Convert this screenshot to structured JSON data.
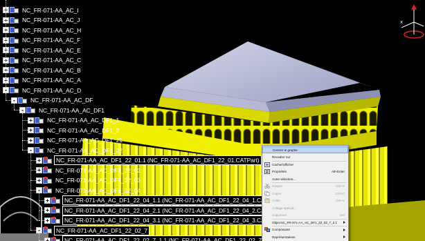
{
  "spec_tree": {
    "nodes": [
      {
        "label": "NC_FR-071-AA_AC_I",
        "level": 0,
        "expander": "+",
        "highlighted": false
      },
      {
        "label": "NC_FR-071-AA_AC_J",
        "level": 0,
        "expander": "+",
        "highlighted": false
      },
      {
        "label": "NC_FR-071-AA_AC_H",
        "level": 0,
        "expander": "+",
        "highlighted": false
      },
      {
        "label": "NC_FR-071-AA_AC_F",
        "level": 0,
        "expander": "+",
        "highlighted": false
      },
      {
        "label": "NC_FR-071-AA_AC_E",
        "level": 0,
        "expander": "+",
        "highlighted": false
      },
      {
        "label": "NC_FR-071-AA_AC_C",
        "level": 0,
        "expander": "+",
        "highlighted": false
      },
      {
        "label": "NC_FR-071-AA_AC_B",
        "level": 0,
        "expander": "+",
        "highlighted": false
      },
      {
        "label": "NC_FR-071-AA_AC_A",
        "level": 0,
        "expander": "+",
        "highlighted": false
      },
      {
        "label": "NC_FR-071-AA_AC_D",
        "level": 0,
        "expander": "-",
        "highlighted": false
      },
      {
        "label": "NC_FR-071-AA_AC_DF",
        "level": 1,
        "expander": "-",
        "highlighted": false
      },
      {
        "label": "NC_FR-071-AA_AC_DF1",
        "level": 2,
        "expander": "-",
        "highlighted": false
      },
      {
        "label": "NC_FR-071-AA_AC_DF1_1",
        "level": 3,
        "expander": "+",
        "highlighted": false
      },
      {
        "label": "NC_FR-071-AA_AC_DF1_2",
        "level": 3,
        "expander": "+",
        "highlighted": false
      },
      {
        "label": "NC_FR-071-AA_AC_DF1_21",
        "level": 3,
        "expander": "+",
        "highlighted": false
      },
      {
        "label": "NC_FR-071-AA_AC_DF1_22",
        "level": 3,
        "expander": "-",
        "highlighted": false
      },
      {
        "label": "NC_FR-071-AA_AC_DF1_22_01.1 (NC_FR-071-AA_AC_DF1_22_01.CATPart)",
        "level": 4,
        "expander": "+",
        "highlighted": true
      },
      {
        "label": "NC_FR-071-AA_AC_DF1_22_02",
        "level": 4,
        "expander": "+",
        "highlighted": false
      },
      {
        "label": "NC_FR-071-AA_AC_DF1_22_03",
        "level": 4,
        "expander": "+",
        "highlighted": false
      },
      {
        "label": "NC_FR-071-AA_AC_DF1_22_04",
        "level": 4,
        "expander": "-",
        "highlighted": false
      },
      {
        "label": "NC_FR-071-AA_AC_DF1_22_04_1.1 (NC_FR-071-AA_AC_DF1_22_04_1.CATPart)",
        "level": 5,
        "expander": "+",
        "highlighted": true
      },
      {
        "label": "NC_FR-071-AA_AC_DF1_22_04_2.1 (NC_FR-071-AA_AC_DF1_22_04_2.CATPart)",
        "level": 5,
        "expander": "+",
        "highlighted": true
      },
      {
        "label": "NC_FR-071-AA_AC_DF1_22_04_3.1 (NC_FR-071-AA_AC_DF1_22_04_3.CATPart)",
        "level": 5,
        "expander": "+",
        "highlighted": true
      },
      {
        "label": "NC_FR-071-AA_AC_DF1_22_02_7",
        "level": 4,
        "expander": "-",
        "highlighted": true
      },
      {
        "label": "NC_FR-071-AA_AC_DF1_22_02_7_1.1 (NC_FR-071-AA_AC_DF1_22_02_7",
        "level": 5,
        "expander": "+",
        "highlighted": true
      }
    ]
  },
  "context_menu": {
    "items": [
      {
        "label": "Centrer le graphe",
        "shortcut": "",
        "icon": "none",
        "disabled": false,
        "submenu": false,
        "hover": true
      },
      {
        "label": "Recadrer sur",
        "shortcut": "",
        "icon": "none",
        "disabled": false,
        "submenu": false,
        "hover": false
      },
      {
        "label": "Cacher/afficher",
        "shortcut": "",
        "icon": "hide-show-icon",
        "disabled": false,
        "submenu": false,
        "hover": false
      },
      {
        "label": "Propriétés",
        "shortcut": "Alt+Enter",
        "icon": "properties-icon",
        "disabled": false,
        "submenu": false,
        "hover": false
      },
      {
        "label": "Autre sélection...",
        "shortcut": "",
        "icon": "none",
        "disabled": false,
        "submenu": false,
        "hover": false
      },
      {
        "label": "Couper",
        "shortcut": "Ctrl+X",
        "icon": "cut-icon",
        "disabled": true,
        "submenu": false,
        "hover": false
      },
      {
        "label": "Copier",
        "shortcut": "Ctrl+C",
        "icon": "copy-icon",
        "disabled": true,
        "submenu": false,
        "hover": false
      },
      {
        "label": "Coller",
        "shortcut": "Ctrl+V",
        "icon": "paste-icon",
        "disabled": true,
        "submenu": false,
        "hover": false
      },
      {
        "label": "Collage spécial...",
        "shortcut": "",
        "icon": "none",
        "disabled": true,
        "submenu": false,
        "hover": false
      },
      {
        "label": "Supprimer",
        "shortcut": "Del",
        "icon": "none",
        "disabled": true,
        "submenu": false,
        "hover": false
      },
      {
        "label": "Objet NC_FR-071-AA_AC_DF1_22_02_7_2.1",
        "shortcut": "",
        "icon": "none",
        "disabled": false,
        "submenu": true,
        "hover": false
      },
      {
        "label": "Composants",
        "shortcut": "",
        "icon": "components-icon",
        "disabled": false,
        "submenu": true,
        "hover": false
      },
      {
        "label": "Représentations",
        "shortcut": "",
        "icon": "none",
        "disabled": false,
        "submenu": true,
        "hover": false
      }
    ],
    "separators_after": [
      1,
      4,
      9,
      10
    ]
  },
  "colors": {
    "model_yellow": "#f2f200",
    "roof_grey": "#b9bbd8",
    "menu_bg": "#f0f0f0",
    "menu_hover": "#bfd6f6"
  }
}
